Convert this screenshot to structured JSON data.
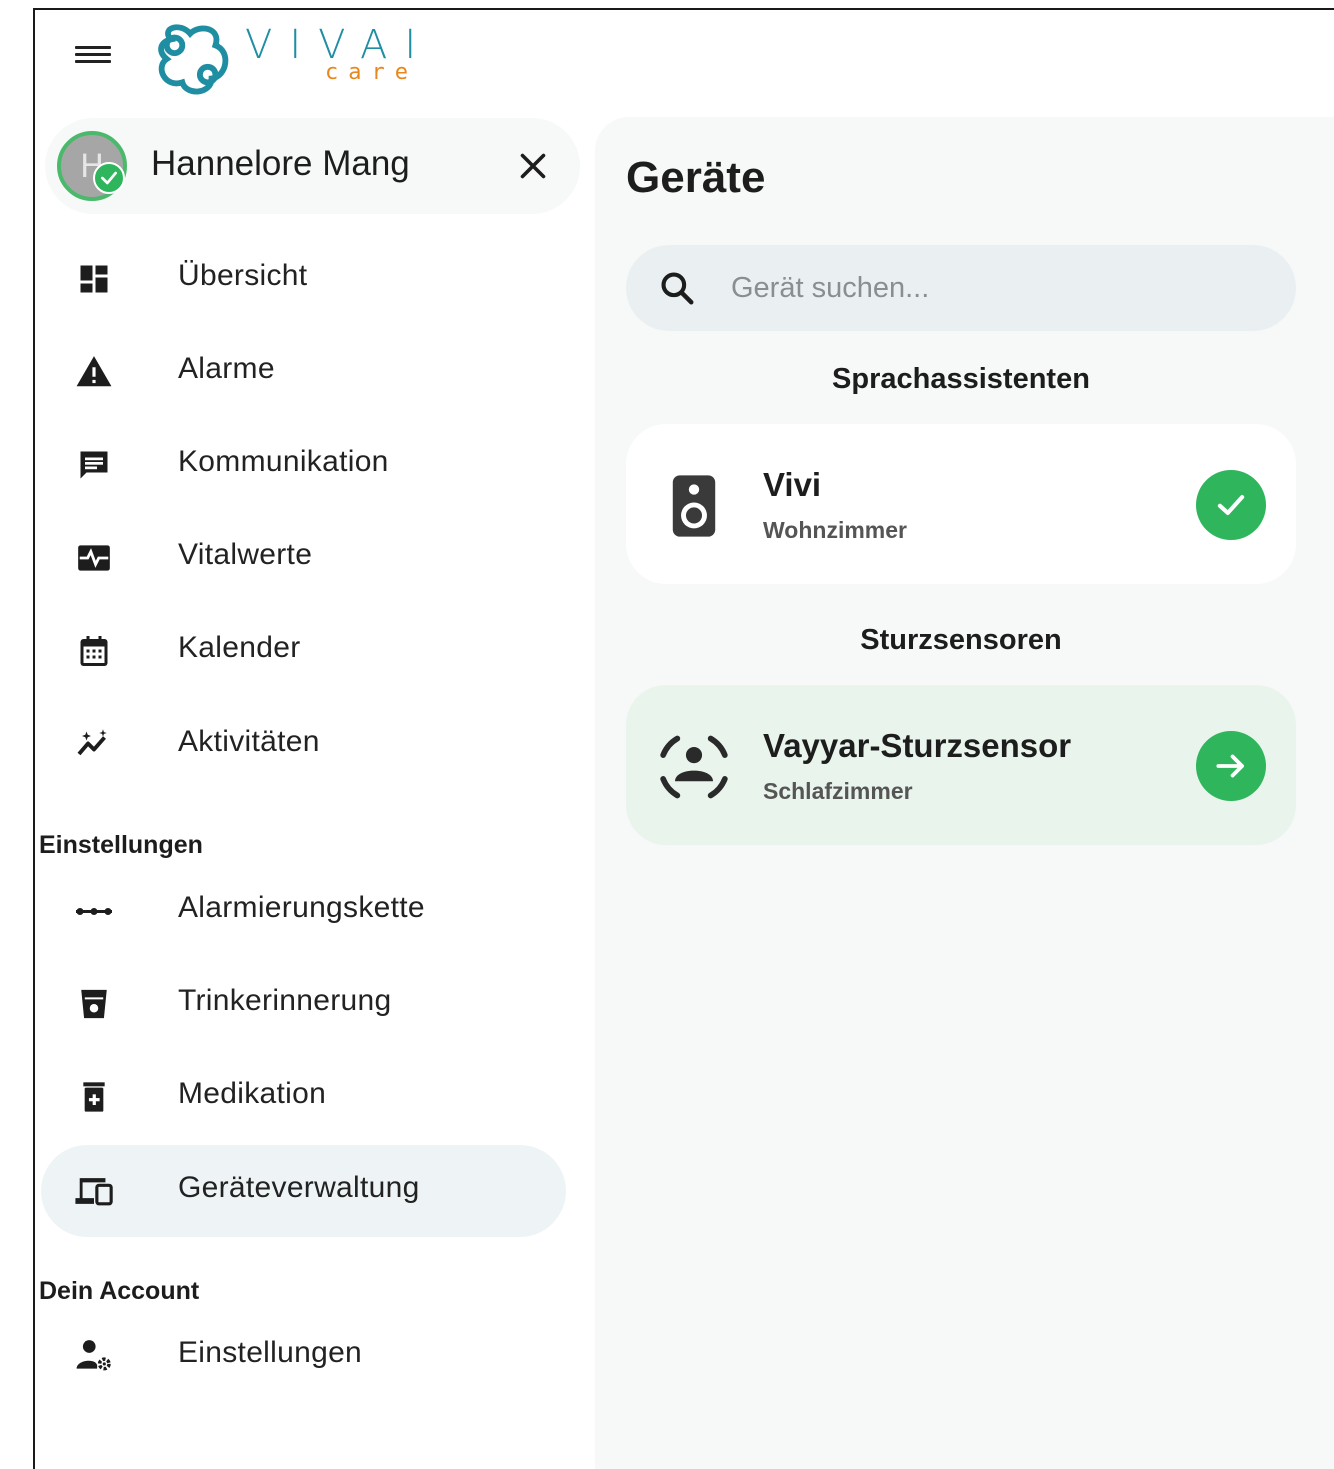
{
  "brand": {
    "name": "VIVAI",
    "sub": "care",
    "primary": "#1f8ea3",
    "accent": "#e8871e"
  },
  "user": {
    "initial": "H",
    "name": "Hannelore Mang",
    "status_color": "#2fb55c"
  },
  "nav": {
    "main_items": [
      {
        "label": "Übersicht",
        "icon": "dashboard-icon"
      },
      {
        "label": "Alarme",
        "icon": "warning-icon"
      },
      {
        "label": "Kommunikation",
        "icon": "chat-icon"
      },
      {
        "label": "Vitalwerte",
        "icon": "vitals-icon"
      },
      {
        "label": "Kalender",
        "icon": "calendar-icon"
      },
      {
        "label": "Aktivitäten",
        "icon": "activity-icon"
      }
    ],
    "settings_heading": "Einstellungen",
    "settings_items": [
      {
        "label": "Alarmierungskette",
        "icon": "chain-icon"
      },
      {
        "label": "Trinkerinnerung",
        "icon": "drink-icon"
      },
      {
        "label": "Medikation",
        "icon": "medication-icon"
      },
      {
        "label": "Geräteverwaltung",
        "icon": "devices-icon",
        "active": true
      }
    ],
    "account_heading": "Dein Account",
    "account_items": [
      {
        "label": "Einstellungen",
        "icon": "user-settings-icon"
      }
    ]
  },
  "main": {
    "title": "Geräte",
    "search": {
      "placeholder": "Gerät suchen...",
      "value": ""
    },
    "groups": [
      {
        "heading": "Sprachassistenten",
        "devices": [
          {
            "name": "Vivi",
            "room": "Wohnzimmer",
            "icon": "speaker-icon",
            "status": "check-icon"
          }
        ]
      },
      {
        "heading": "Sturzsensoren",
        "devices": [
          {
            "name": "Vayyar-Sturzsensor",
            "room": "Schlafzimmer",
            "icon": "fall-sensor-icon",
            "status": "arrow-right-icon"
          }
        ]
      }
    ]
  }
}
